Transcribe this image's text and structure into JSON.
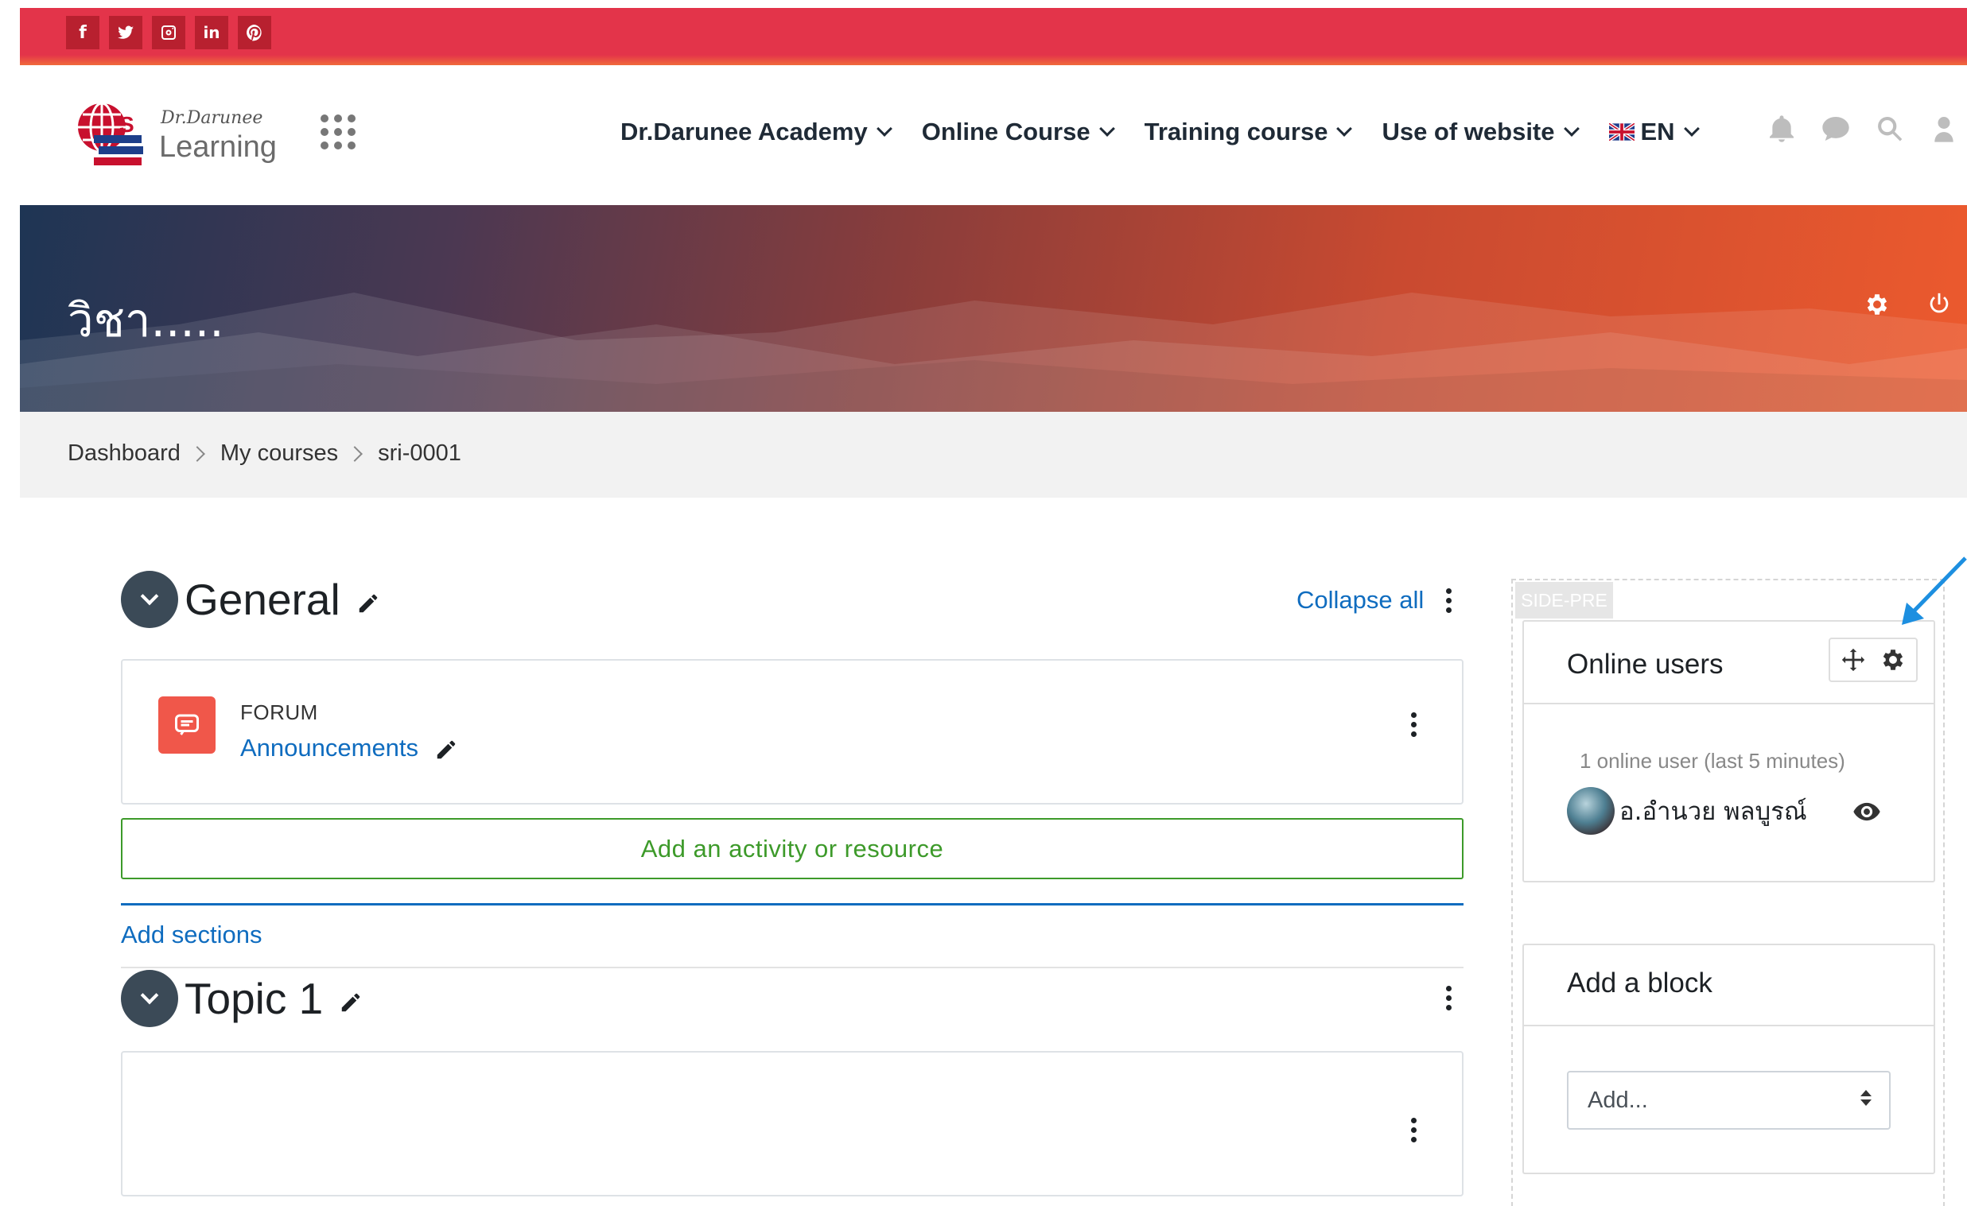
{
  "social": {
    "icons": [
      "facebook-icon",
      "twitter-icon",
      "instagram-icon",
      "linkedin-icon",
      "pinterest-icon"
    ],
    "facebook_glyph": "f",
    "linkedin_glyph": "in"
  },
  "brand": {
    "line1": "Dr.Darunee",
    "line2": "Learning"
  },
  "nav": {
    "items": [
      {
        "label": "Dr.Darunee Academy"
      },
      {
        "label": "Online Course"
      },
      {
        "label": "Training course"
      },
      {
        "label": "Use of website"
      }
    ],
    "language": "EN"
  },
  "header": {
    "course_title": "วิชา....."
  },
  "breadcrumb": [
    "Dashboard",
    "My courses",
    "sri-0001"
  ],
  "sections": {
    "general": {
      "title": "General",
      "collapse_all": "Collapse all",
      "activity": {
        "type": "FORUM",
        "name": "Announcements"
      },
      "add_activity": "Add an activity or resource",
      "add_sections": "Add sections"
    },
    "topic1": {
      "title": "Topic 1"
    }
  },
  "side": {
    "region_label": "SIDE-PRE",
    "online_users": {
      "title": "Online users",
      "count_text": "1 online user (last 5 minutes)",
      "user_name": "อ.อำนวย พลบูรณ์"
    },
    "add_block": {
      "title": "Add a block",
      "select_value": "Add..."
    }
  },
  "colors": {
    "topbar": "#e3344a",
    "link": "#0f6cbf",
    "add_activity": "#3d9a2a",
    "forum_icon_bg": "#f0574a"
  }
}
